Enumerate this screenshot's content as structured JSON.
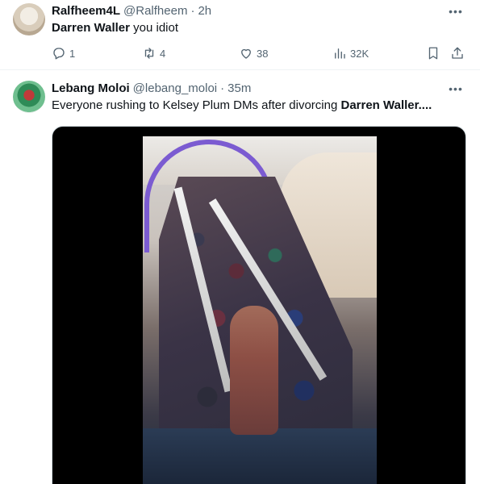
{
  "tweets": [
    {
      "name": "Ralfheem4L",
      "handle": "@Ralfheem",
      "dot": "·",
      "time": "2h",
      "text_bold": "Darren Waller",
      "text_rest": " you idiot",
      "replies": "1",
      "retweets": "4",
      "likes": "38",
      "views": "32K",
      "more": "•••"
    },
    {
      "name": "Lebang Moloi",
      "handle": "@lebang_moloi",
      "dot": "·",
      "time": "35m",
      "text_plain": "Everyone rushing to Kelsey Plum DMs after divorcing ",
      "text_bold": "Darren Waller....",
      "more": "•••"
    }
  ],
  "icons": {
    "reply": "reply-icon",
    "retweet": "retweet-icon",
    "like": "heart-icon",
    "views": "views-icon",
    "bookmark": "bookmark-icon",
    "share": "share-icon"
  },
  "colors": {
    "text": "#0f1419",
    "muted": "#536471",
    "divider": "#eff3f4"
  }
}
